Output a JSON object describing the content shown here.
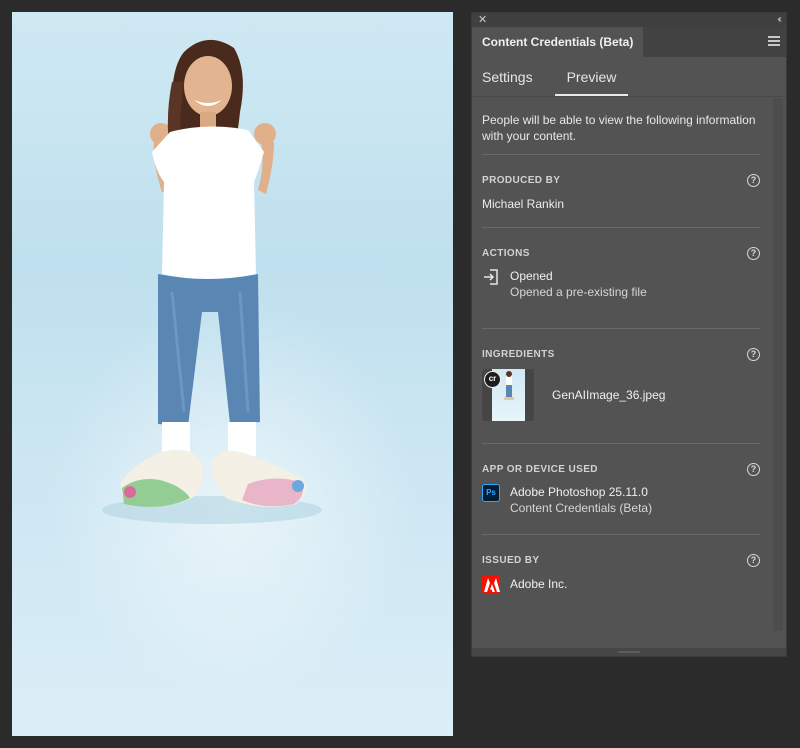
{
  "panel": {
    "tab_title": "Content Credentials (Beta)",
    "close_glyph": "✕",
    "collapse_glyph": "‹‹",
    "subtabs": [
      "Settings",
      "Preview"
    ],
    "active_subtab": "Preview",
    "intro": "People will be able to view the following information with your content.",
    "help_glyph": "?",
    "sections": {
      "produced_by": {
        "title": "PRODUCED BY",
        "value": "Michael Rankin"
      },
      "actions": {
        "title": "ACTIONS",
        "icon": "open-file-icon",
        "main": "Opened",
        "sub": "Opened a pre-existing file"
      },
      "ingredients": {
        "title": "INGREDIENTS",
        "badge": "cr",
        "filename": "GenAIImage_36.jpeg"
      },
      "app": {
        "title": "APP OR DEVICE USED",
        "icon_label": "Ps",
        "main": "Adobe Photoshop 25.11.0",
        "sub": "Content Credentials (Beta)"
      },
      "issued_by": {
        "title": "ISSUED BY",
        "icon": "adobe-logo-icon",
        "value": "Adobe Inc."
      }
    }
  },
  "colors": {
    "panel_bg": "#535353",
    "tabbar_bg": "#424242",
    "photo_bg": "#cfe9f3",
    "ps_blue": "#31a8ff",
    "adobe_red": "#fa0f00"
  }
}
